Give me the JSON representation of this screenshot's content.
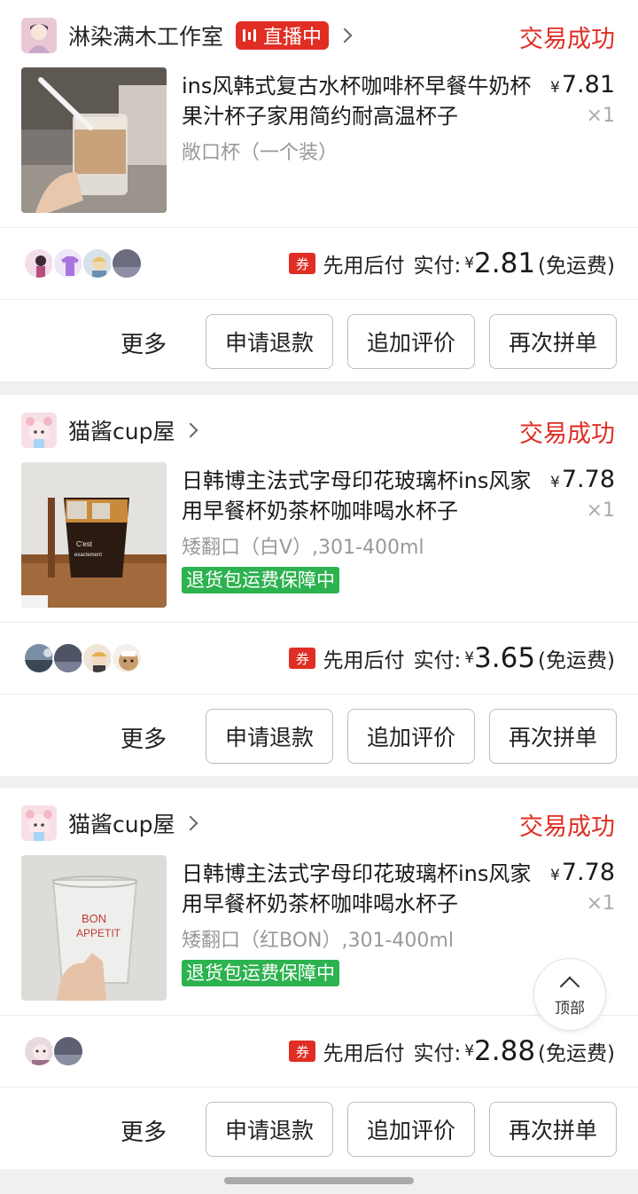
{
  "colors": {
    "accent": "#e02e24",
    "tag_green": "#2cb24f"
  },
  "orders": [
    {
      "shop": "淋染满木工作室",
      "live": "直播中",
      "status": "交易成功",
      "title": "ins风韩式复古水杯咖啡杯早餐牛奶杯果汁杯子家用简约耐高温杯子",
      "spec": "敞口杯（一个装）",
      "price": "7.81",
      "qty": "×1",
      "coupon": "券",
      "pay_label": "先用后付",
      "paid_label": "实付:",
      "yen": "¥",
      "amount": "2.81",
      "shipping": "(免运费)",
      "more": "更多",
      "btn_refund": "申请退款",
      "btn_review": "追加评价",
      "btn_rebuy": "再次拼单"
    },
    {
      "shop": "猫酱cup屋",
      "status": "交易成功",
      "title": "日韩博主法式字母印花玻璃杯ins风家用早餐杯奶茶杯咖啡喝水杯子",
      "spec": "矮翻口（白V）,301-400ml",
      "tag": "退货包运费保障中",
      "price": "7.78",
      "qty": "×1",
      "coupon": "券",
      "pay_label": "先用后付",
      "paid_label": "实付:",
      "yen": "¥",
      "amount": "3.65",
      "shipping": "(免运费)",
      "more": "更多",
      "btn_refund": "申请退款",
      "btn_review": "追加评价",
      "btn_rebuy": "再次拼单"
    },
    {
      "shop": "猫酱cup屋",
      "status": "交易成功",
      "title": "日韩博主法式字母印花玻璃杯ins风家用早餐杯奶茶杯咖啡喝水杯子",
      "spec": "矮翻口（红BON）,301-400ml",
      "tag": "退货包运费保障中",
      "price": "7.78",
      "qty": "×1",
      "coupon": "券",
      "pay_label": "先用后付",
      "paid_label": "实付:",
      "yen": "¥",
      "amount": "2.88",
      "shipping": "(免运费)",
      "more": "更多",
      "btn_refund": "申请退款",
      "btn_review": "追加评价",
      "btn_rebuy": "再次拼单"
    }
  ],
  "back_to_top": "顶部"
}
